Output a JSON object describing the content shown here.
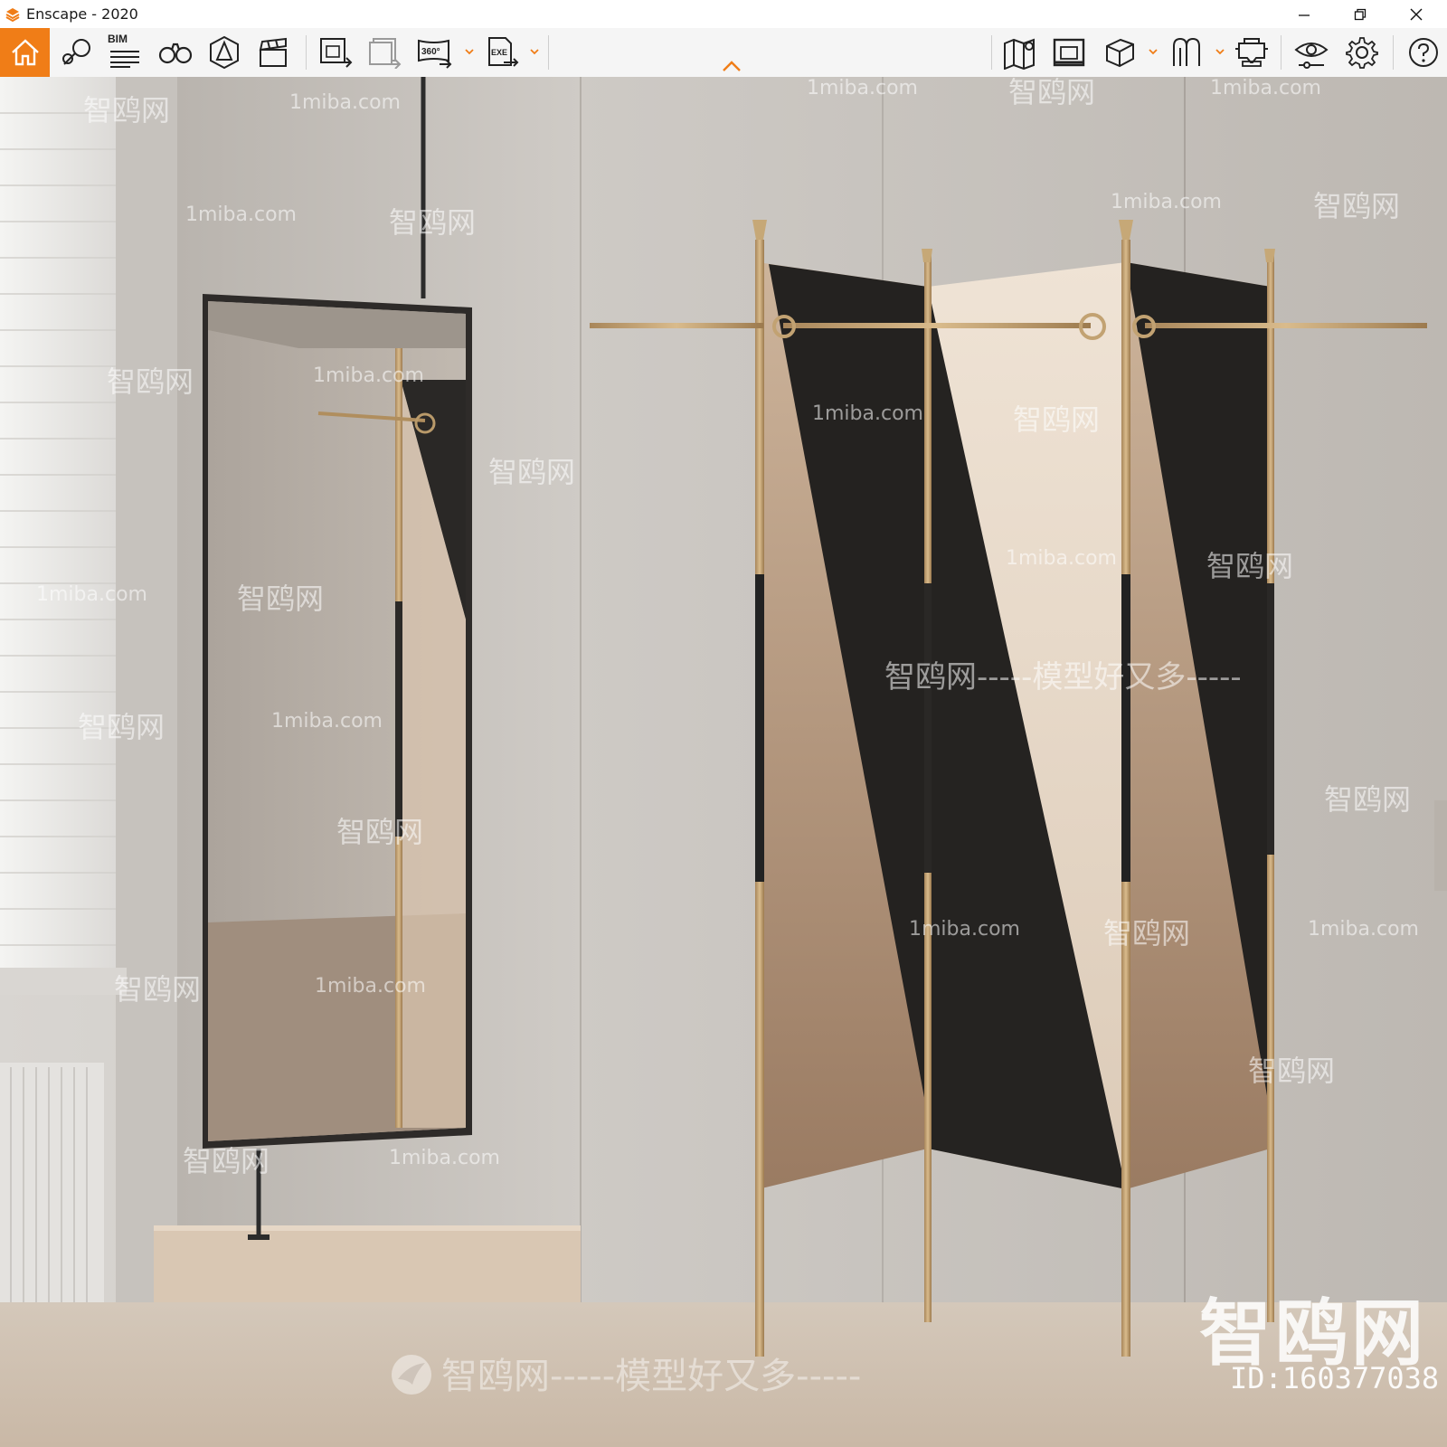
{
  "window": {
    "title": "Enscape - 2020",
    "controls": [
      "minimize-icon",
      "restore-icon",
      "close-icon"
    ]
  },
  "toolbar": {
    "accent": "#f07d17",
    "bim_label": "BIM",
    "badge_360": "360°",
    "badge_exe": "EXE",
    "left_tools": [
      "home-icon",
      "assets-icon",
      "bim-info-icon",
      "binoculars-icon",
      "light-view-icon",
      "clapper-icon",
      "render-export-icon",
      "batch-render-icon",
      "panorama-360-icon",
      "exe-export-icon"
    ],
    "right_tools": [
      "map-icon",
      "view-management-icon",
      "cube-icon",
      "multi-view-icon",
      "vr-headset-icon",
      "visual-settings-icon",
      "settings-gear-icon",
      "help-icon"
    ]
  },
  "watermarks": {
    "site": "1miba.com",
    "brand": "智鸥网",
    "slogan": "智鸥网-----模型好又多-----",
    "big": "智鸥网",
    "id": "ID:160377038"
  }
}
